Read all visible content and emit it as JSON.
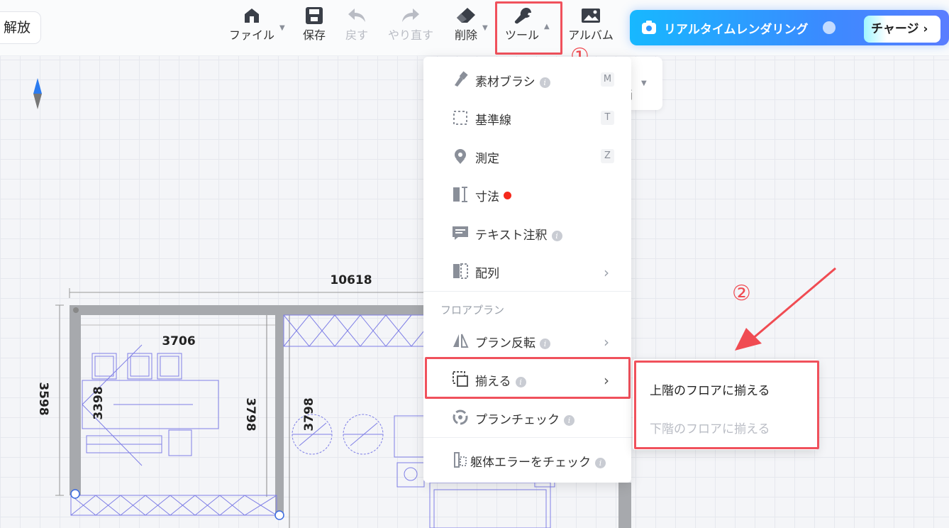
{
  "toolbar": {
    "release_label": "解放",
    "items": [
      {
        "label": "ファイル",
        "icon": "home-icon"
      },
      {
        "label": "保存",
        "icon": "save-icon"
      },
      {
        "label": "戻す",
        "icon": "undo-icon",
        "disabled": true
      },
      {
        "label": "やり直す",
        "icon": "redo-icon",
        "disabled": true
      },
      {
        "label": "削除",
        "icon": "eraser-icon"
      },
      {
        "label": "ツール",
        "icon": "wrench-icon"
      },
      {
        "label": "アルバム",
        "icon": "album-icon"
      }
    ],
    "render_label": "リアルタイムレンダリング",
    "charge_label": "チャージ"
  },
  "annotations": {
    "step1": "①",
    "step2": "②",
    "highlight_color": "#f0515c"
  },
  "behind_panel": {
    "text": "画"
  },
  "tools_menu": {
    "items": [
      {
        "label": "素材ブラシ",
        "key": "M",
        "icon": "brush-icon"
      },
      {
        "label": "基準線",
        "key": "T",
        "icon": "guideline-icon"
      },
      {
        "label": "測定",
        "key": "Z",
        "icon": "measure-icon"
      },
      {
        "label": "寸法",
        "icon": "dimension-icon"
      },
      {
        "label": "テキスト注釈",
        "icon": "text-note-icon"
      },
      {
        "label": "配列",
        "icon": "array-icon"
      }
    ],
    "section_floorplan": "フロアプラン",
    "floorplan_items": [
      {
        "label": "プラン反転",
        "icon": "flip-icon"
      },
      {
        "label": "揃える",
        "icon": "align-icon"
      },
      {
        "label": "プランチェック",
        "icon": "plan-check-icon"
      }
    ],
    "error_check": "躯体エラーをチェック"
  },
  "align_submenu": {
    "upper": "上階のフロアに揃える",
    "lower": "下階のフロアに揃える"
  },
  "floorplan": {
    "dim_total": "10618",
    "dim_room_width": "3706",
    "dim_left": "3598",
    "dim_inner": "3398",
    "dim_right_1": "3798",
    "dim_right_2": "3798"
  }
}
